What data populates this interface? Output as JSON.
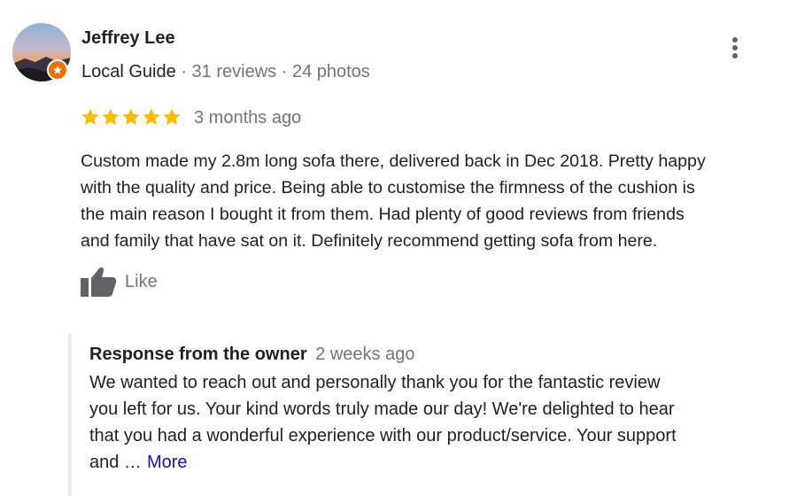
{
  "review": {
    "reviewer": {
      "name": "Jeffrey Lee",
      "badge": "Local Guide",
      "reviews": "31 reviews",
      "photos": "24 photos",
      "separator": "·",
      "avatar_icon": "sunset-avatar",
      "badge_icon": "local-guide-star-icon",
      "badge_color": "#e8710a"
    },
    "menu_icon": "more-vert-icon",
    "rating": 5,
    "rating_max": 5,
    "star_color": "#fbbc04",
    "time": "3 months ago",
    "text_lines": [
      "Custom made my 2.8m long sofa there, delivered back in Dec 2018. Pretty happy",
      "with the quality and price. Being able to customise the firmness of the cushion is",
      "the main reason I bought it from them. Had plenty of good reviews from friends",
      "and family that have sat on it. Definitely recommend getting sofa from here."
    ],
    "like": {
      "label": "Like",
      "icon": "thumbs-up-icon"
    }
  },
  "owner_response": {
    "title": "Response from the owner",
    "time": "2 weeks ago",
    "text_lines": [
      "We wanted to reach out and personally thank you for the fantastic review",
      "you left for us. Your kind words truly made our day! We're delighted to hear",
      "that you had a wonderful experience with our product/service. Your support",
      "and …"
    ],
    "more_label": "More",
    "link_color": "#1a0dab"
  }
}
